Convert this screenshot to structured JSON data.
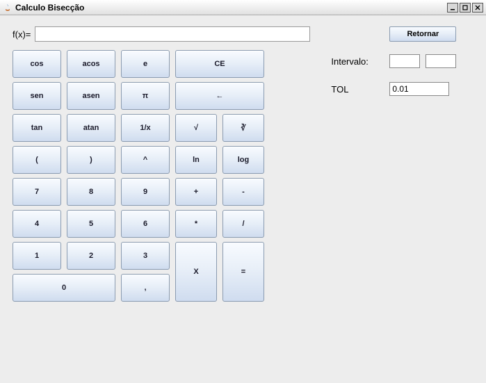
{
  "window": {
    "title": "Calculo Bisecção"
  },
  "fx": {
    "label": "f(x)=",
    "value": ""
  },
  "sidebar": {
    "btn_retornar": "Retornar",
    "intervalo_label": "Intervalo:",
    "intervalo_a": "",
    "intervalo_b": "",
    "tol_label": "TOL",
    "tol_value": "0.01"
  },
  "keys": {
    "cos": "cos",
    "acos": "acos",
    "e": "e",
    "ce": "CE",
    "sen": "sen",
    "asen": "asen",
    "pi": "π",
    "back": "←",
    "tan": "tan",
    "atan": "atan",
    "inv": "1/x",
    "sqrt": "√",
    "cbrt": "∛",
    "lpar": "(",
    "rpar": ")",
    "pow": "^",
    "ln": "ln",
    "log": "log",
    "n7": "7",
    "n8": "8",
    "n9": "9",
    "plus": "+",
    "minus": "-",
    "n4": "4",
    "n5": "5",
    "n6": "6",
    "mul": "*",
    "div": "/",
    "n1": "1",
    "n2": "2",
    "n3": "3",
    "x": "X",
    "eq": "=",
    "n0": "0",
    "comma": ","
  }
}
